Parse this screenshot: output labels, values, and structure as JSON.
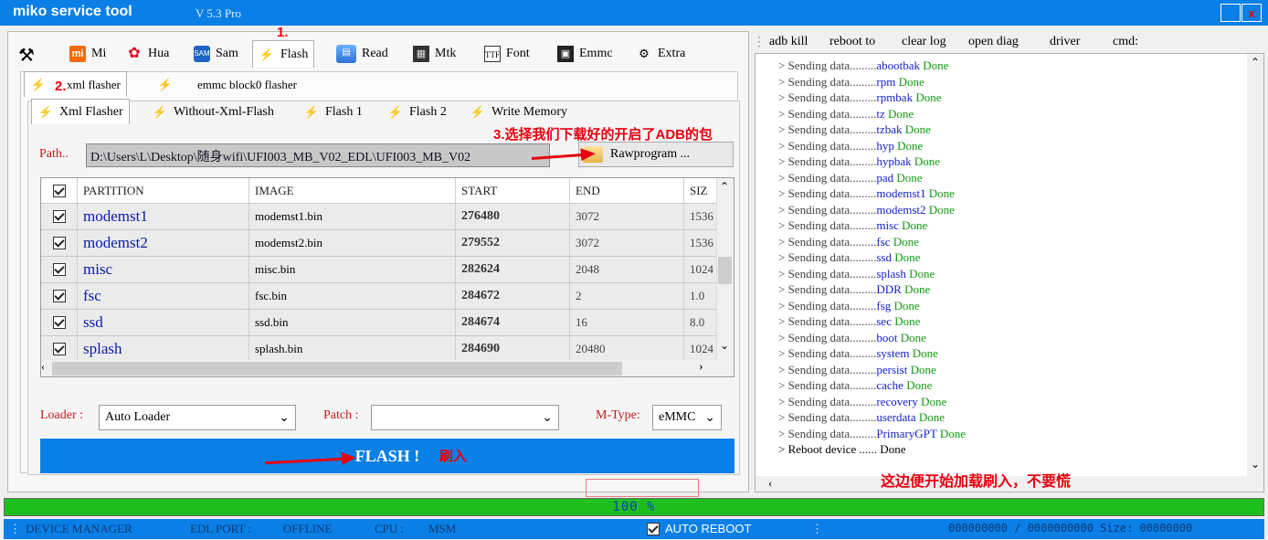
{
  "window": {
    "title": "miko service tool",
    "version": "V 5.3 Pro",
    "close_glyph": "x"
  },
  "main_tabs": [
    {
      "label": "Mi",
      "icon": "xiaomi-icon"
    },
    {
      "label": "Hua",
      "icon": "huawei-icon"
    },
    {
      "label": "Sam",
      "icon": "samsung-icon"
    },
    {
      "label": "Flash",
      "icon": "lightning-icon"
    },
    {
      "label": "Read",
      "icon": "database-icon"
    },
    {
      "label": "Mtk",
      "icon": "chip-icon"
    },
    {
      "label": "Font",
      "icon": "font-file-icon"
    },
    {
      "label": "Emmc",
      "icon": "emmc-icon"
    },
    {
      "label": "Extra",
      "icon": "extra-icon"
    }
  ],
  "annotations": {
    "step1": "1.",
    "step2": "2.",
    "step3": "3.选择我们下载好的开启了ADB的包",
    "flash_note": "刷入",
    "log_note": "这边便开始加载刷入，不要慌"
  },
  "sub_tabs": [
    "xml flasher",
    "emmc block0 flasher"
  ],
  "inner_tabs": [
    "Xml Flasher",
    "Without-Xml-Flash",
    "Flash 1",
    "Flash 2",
    "Write Memory"
  ],
  "path": {
    "label": "Path..",
    "value": "D:\\Users\\L\\Desktop\\随身wifi\\UFI003_MB_V02_EDL\\UFI003_MB_V02",
    "button": "Rawprogram ..."
  },
  "table": {
    "headers": [
      "PARTITION",
      "IMAGE",
      "START",
      "END",
      "SIZ"
    ],
    "rows": [
      {
        "partition": "modemst1",
        "image": "modemst1.bin",
        "start": "276480",
        "end": "3072",
        "size": "1536"
      },
      {
        "partition": "modemst2",
        "image": "modemst2.bin",
        "start": "279552",
        "end": "3072",
        "size": "1536"
      },
      {
        "partition": "misc",
        "image": "misc.bin",
        "start": "282624",
        "end": "2048",
        "size": "1024"
      },
      {
        "partition": "fsc",
        "image": "fsc.bin",
        "start": "284672",
        "end": "2",
        "size": "1.0"
      },
      {
        "partition": "ssd",
        "image": "ssd.bin",
        "start": "284674",
        "end": "16",
        "size": "8.0"
      },
      {
        "partition": "splash",
        "image": "splash.bin",
        "start": "284690",
        "end": "20480",
        "size": "1024"
      }
    ]
  },
  "loader": {
    "label": "Loader :",
    "value": "Auto Loader"
  },
  "patch": {
    "label": "Patch :",
    "value": ""
  },
  "mtype": {
    "label": "M-Type:",
    "value": "eMMC"
  },
  "flash_button": "FLASH !",
  "commands": [
    "adb kill",
    "reboot to",
    "clear log",
    "open diag",
    "driver",
    "cmd:"
  ],
  "log": {
    "prefix": "> Sending data.........",
    "done": "Done",
    "partitions": [
      "abootbak",
      "rpm",
      "rpmbak",
      "tz",
      "tzbak",
      "hyp",
      "hypbak",
      "pad",
      "modemst1",
      "modemst2",
      "misc",
      "fsc",
      "ssd",
      "splash",
      "DDR",
      "fsg",
      "sec",
      "boot",
      "system",
      "persist",
      "cache",
      "recovery",
      "userdata",
      "PrimaryGPT"
    ],
    "final": "> Reboot device ...... Done"
  },
  "progress": {
    "text": "100 %",
    "value": 100
  },
  "status": {
    "device_manager": "DEVICE MANAGER",
    "edl_port": "EDL PORT :",
    "port_value": "OFFLINE",
    "cpu": "CPU :",
    "cpu_value": "MSM",
    "auto_reboot": "AUTO REBOOT",
    "counter": "000000000 / 0000000000 Size: 00000000"
  }
}
